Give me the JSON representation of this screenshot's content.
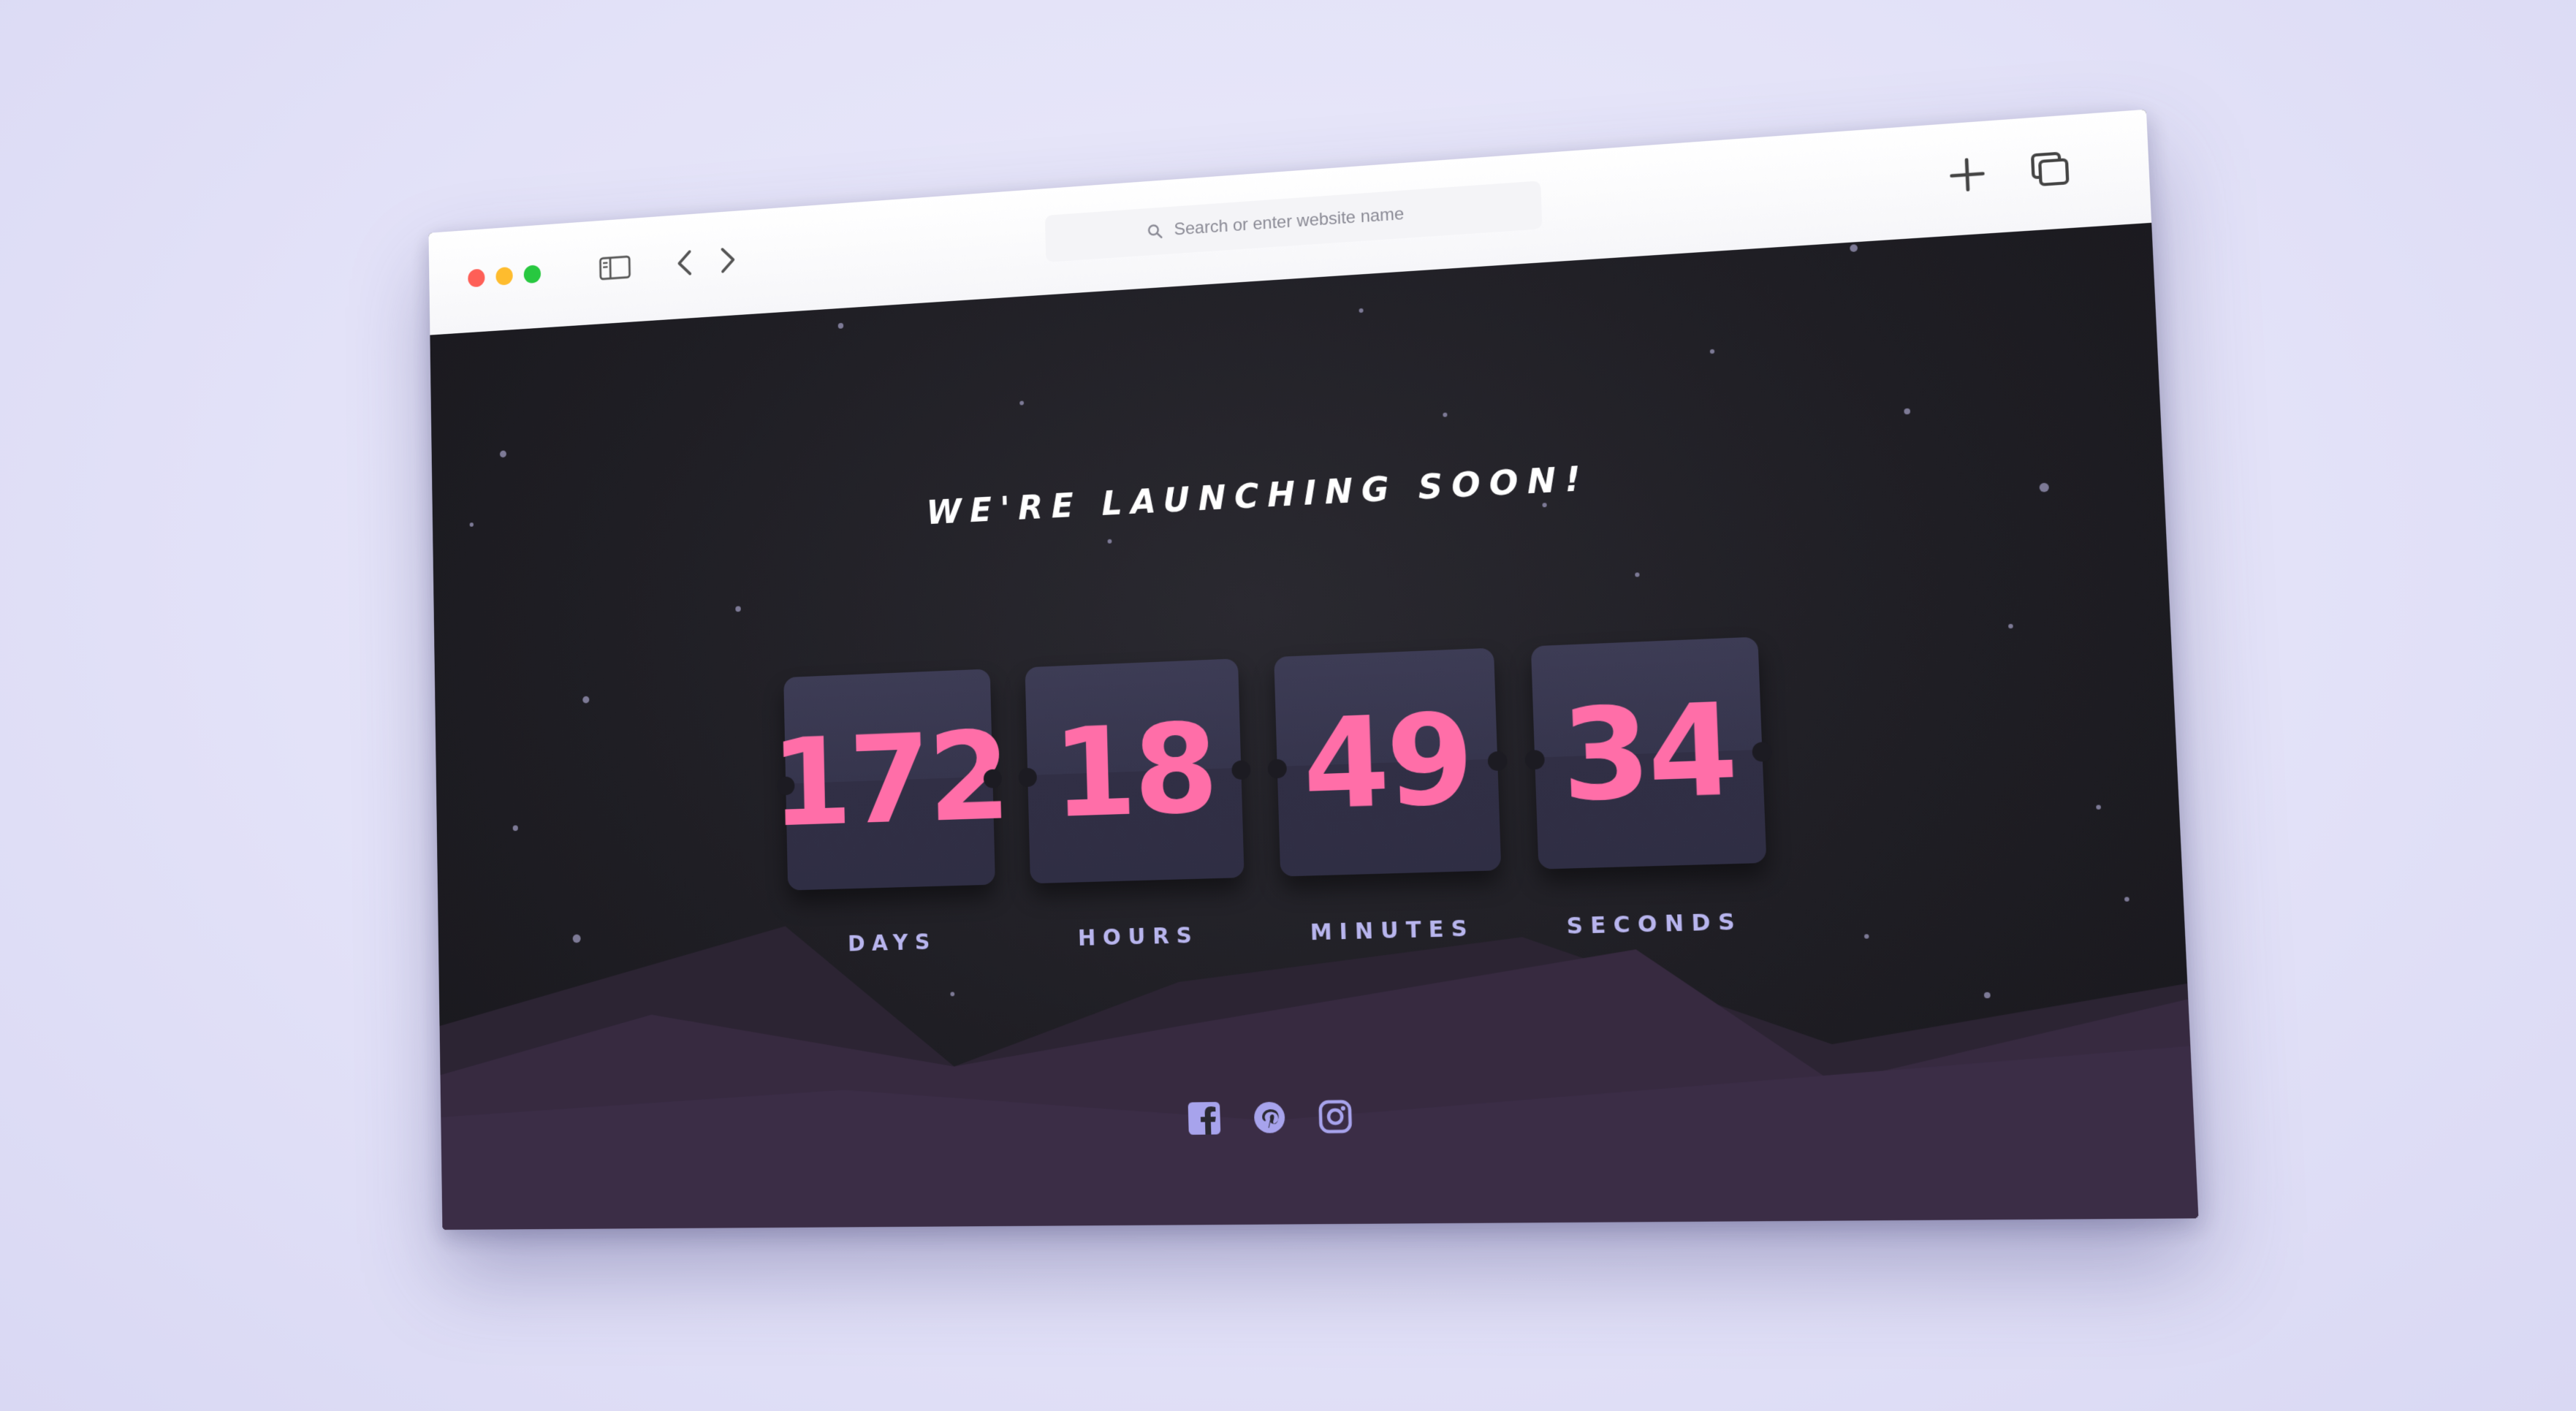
{
  "browser": {
    "address_placeholder": "Search or enter website name",
    "icons": [
      "sidebar-icon",
      "back-icon",
      "forward-icon",
      "search-icon",
      "plus-icon",
      "tabs-icon"
    ]
  },
  "page": {
    "headline": "WE'RE LAUNCHING SOON!",
    "countdown": [
      {
        "value": "172",
        "label": "DAYS"
      },
      {
        "value": "18",
        "label": "HOURS"
      },
      {
        "value": "49",
        "label": "MINUTES"
      },
      {
        "value": "34",
        "label": "SECONDS"
      }
    ],
    "social": [
      "facebook-icon",
      "pinterest-icon",
      "instagram-icon"
    ]
  },
  "colors": {
    "background": "#1f1e24",
    "accent_pink": "#ff6ea8",
    "label_lavender": "#b8b5ee",
    "card": "#36354d",
    "mountain": "#3a2d45"
  }
}
